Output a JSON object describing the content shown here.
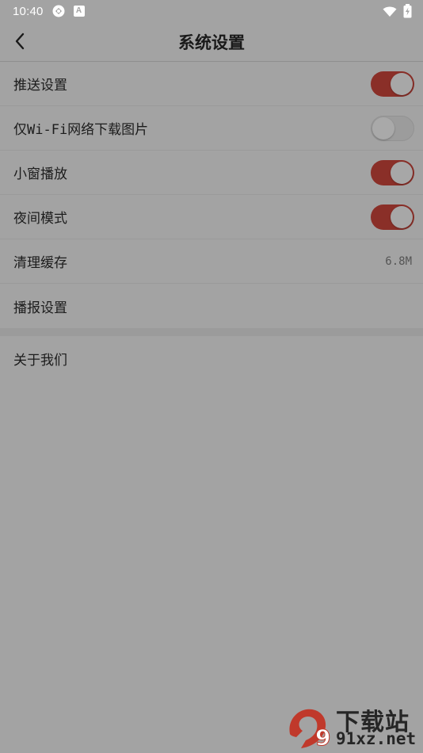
{
  "status_bar": {
    "time": "10:40",
    "notification_badge": "A",
    "icons": [
      "sync-icon",
      "app-notification-icon",
      "wifi-icon",
      "battery-charging-icon"
    ]
  },
  "header": {
    "title": "系统设置",
    "back_icon": "chevron-left-icon"
  },
  "settings": [
    {
      "label": "推送设置",
      "type": "toggle",
      "enabled": true
    },
    {
      "label": "仅Wi-Fi网络下载图片",
      "type": "toggle",
      "enabled": false
    },
    {
      "label": "小窗播放",
      "type": "toggle",
      "enabled": true
    },
    {
      "label": "夜间模式",
      "type": "toggle",
      "enabled": true
    },
    {
      "label": "清理缓存",
      "type": "value",
      "value": "6.8M"
    },
    {
      "label": "播报设置",
      "type": "link"
    }
  ],
  "about": {
    "label": "关于我们"
  },
  "watermark": {
    "logo_text": "9",
    "title": "下载站",
    "url": "91xz.net"
  },
  "colors": {
    "overlay_background": "#a3a3a3",
    "toggle_on": "#8a2f28",
    "toggle_off": "#9c9c9c",
    "watermark_red": "#c0392b"
  }
}
